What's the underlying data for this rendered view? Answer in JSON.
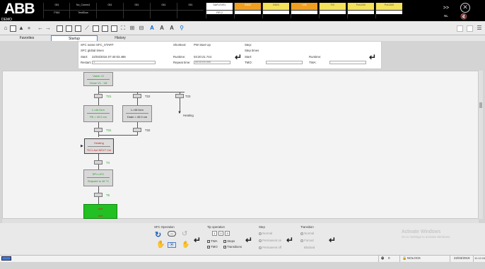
{
  "app": {
    "logo": "ABB",
    "mode": "DEMO"
  },
  "alarms": [
    {
      "r1": "051",
      "r2": "F561",
      "style": "d"
    },
    {
      "r1": "No_Comm4",
      "r2": "TestSlow",
      "style": "d"
    },
    {
      "r1": "051",
      "r2": "",
      "style": "d"
    },
    {
      "r1": "051",
      "r2": "",
      "style": "d"
    },
    {
      "r1": "051",
      "r2": "",
      "style": "d"
    },
    {
      "r1": "051",
      "r2": "",
      "style": "d"
    },
    {
      "r1": "SAFLEVEL",
      "r2": "FIR 2",
      "style": "w"
    },
    {
      "r1": "B502",
      "r2": "RUNTIME",
      "style": "o"
    },
    {
      "r1": "B503",
      "r2": "PROTECT",
      "style": "y"
    },
    {
      "r1": "L00",
      "r2": "RUNTIME",
      "style": "o"
    },
    {
      "r1": "FIC",
      "r2": "0100",
      "style": "y"
    },
    {
      "r1": "Pot1200",
      "r2": "Low",
      "style": "y"
    },
    {
      "r1": "Pot1300",
      "r2": "Low",
      "style": "y"
    }
  ],
  "more": {
    "label": ">>",
    "sub": "NL"
  },
  "tabs": {
    "favorites": "Favorites",
    "startup": "Startup",
    "history": "History"
  },
  "info": {
    "sfc_name_label": "SFC name:",
    "sfc_name": "SFC_START",
    "shorttext_label": "Shorttext:",
    "shorttext": "PW Start Up",
    "global_label": "SFC global times",
    "start_label": "Start:",
    "start": "22/03/2016 07:40:03.486",
    "runtime_label": "Runtime:",
    "runtime": "03:20:21.744",
    "restart_label": "Restart:",
    "restart": "1",
    "repeat_label": "Repeat time:",
    "repeat": "00:00:00.000",
    "step_label": "Step:",
    "step_times_label": "Step times",
    "step_start_label": "Start:",
    "step_runtime_label": "Runtime:",
    "tmo_label": "TMO:",
    "twa_label": "TWA:"
  },
  "diagram": {
    "s1a": "Valve <0",
    "s1b": "Close V1 - V8",
    "t21": "T21",
    "t22": "T22",
    "t23": "T23",
    "s2a": "L<40.0cm",
    "s2b": "Fill > 40.0 cm",
    "s3a": "L>45.0cm",
    "s3b": "Drain < 45.0 cm",
    "heating_arrow": "Heating",
    "t31": "T31",
    "t32": "T32",
    "s4a": "Heating",
    "s4b": "TIC1 Aut NEXT Cel",
    "t4": "T4",
    "s5a": "SP>=4*C",
    "s5b": "Setpoint to 45 °C",
    "t5": "T5",
    "s6a": "###",
    "s6b": "###"
  },
  "bottom": {
    "sfc_op": "SFC Operation",
    "tip_op": "Tip operation",
    "tip_nums": [
      "1",
      "2",
      "3"
    ],
    "twa": "TWA",
    "steps": "Steps",
    "tmo": "TMO",
    "transitions": "Transitions",
    "step": "Step",
    "normal": "Normal",
    "perm_on": "Permanent on",
    "perm_off": "Permanent off",
    "transition": "Transition",
    "t_normal": "Normal",
    "forced": "Forced",
    "blocked": "Blocked",
    "wm1": "Activate Windows",
    "wm2": "Go to Settings to activate Windows."
  },
  "status": {
    "count": "0",
    "lock": "NOLOCK",
    "date": "22/03/2019",
    "time": "11:12:24"
  }
}
